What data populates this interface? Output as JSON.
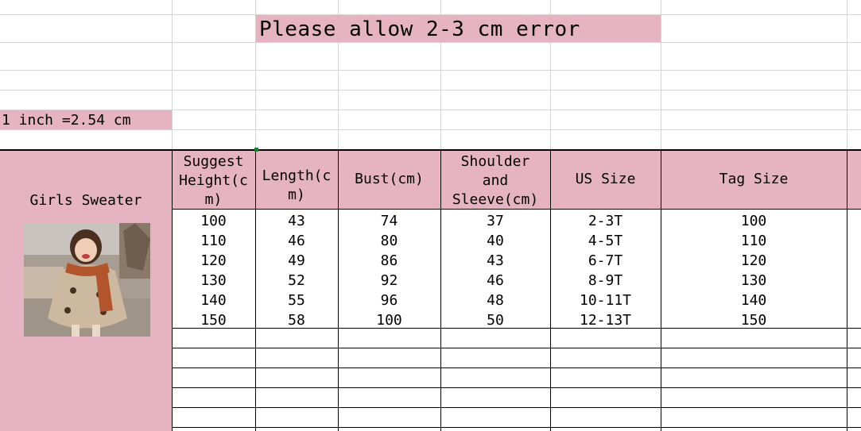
{
  "banner": {
    "text": "Please allow 2-3 cm error"
  },
  "conversion": {
    "text": "1 inch =2.54 cm"
  },
  "product": {
    "name": "Girls Sweater",
    "photo_alt": "girl-in-sweater-photo"
  },
  "table": {
    "headers": [
      "Suggest Height(c m)",
      "Length(c m)",
      "Bust(cm)",
      "Shoulder and Sleeve(cm)",
      "US Size",
      "Tag Size"
    ],
    "header_lines": [
      [
        "Suggest",
        "Height(c",
        "m)"
      ],
      [
        "Length(c",
        "m)"
      ],
      [
        "Bust(cm)"
      ],
      [
        "Shoulder",
        "and",
        "Sleeve(cm)"
      ],
      [
        "US Size"
      ],
      [
        "Tag Size"
      ]
    ],
    "rows": [
      [
        "100",
        "43",
        "74",
        "37",
        "2-3T",
        "100"
      ],
      [
        "110",
        "46",
        "80",
        "40",
        "4-5T",
        "110"
      ],
      [
        "120",
        "49",
        "86",
        "43",
        "6-7T",
        "120"
      ],
      [
        "130",
        "52",
        "92",
        "46",
        "8-9T",
        "130"
      ],
      [
        "140",
        "55",
        "96",
        "48",
        "10-11T",
        "140"
      ],
      [
        "150",
        "58",
        "100",
        "50",
        "12-13T",
        "150"
      ]
    ]
  },
  "colors": {
    "highlight": "#e6b3c3",
    "grid": "#d4d4d4",
    "border": "#000000"
  }
}
